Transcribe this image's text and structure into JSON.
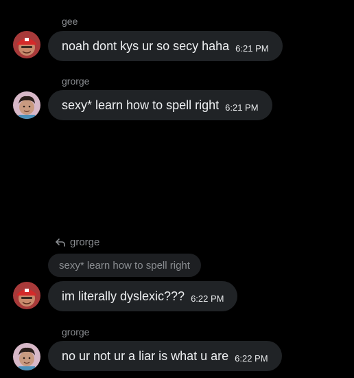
{
  "messages": [
    {
      "sender": "gee",
      "avatar": "red-cap-avatar",
      "text": "noah dont kys ur so secy haha",
      "time": "6:21 PM"
    },
    {
      "sender": "grorge",
      "avatar": "curly-hair-avatar",
      "text": "sexy* learn how to spell right",
      "time": "6:21 PM"
    },
    {
      "reply_to": {
        "sender": "grorge",
        "text": "sexy* learn how to spell right",
        "icon": "reply-icon"
      },
      "avatar": "red-cap-avatar",
      "text": "im literally dyslexic???",
      "time": "6:22 PM"
    },
    {
      "sender": "grorge",
      "avatar": "curly-hair-avatar",
      "text": "no ur not ur a liar is what u are",
      "time": "6:22 PM"
    }
  ],
  "colors": {
    "background": "#000000",
    "bubble": "#202326",
    "reply_quote": "#1d1f22",
    "muted_text": "#8a8d91"
  }
}
